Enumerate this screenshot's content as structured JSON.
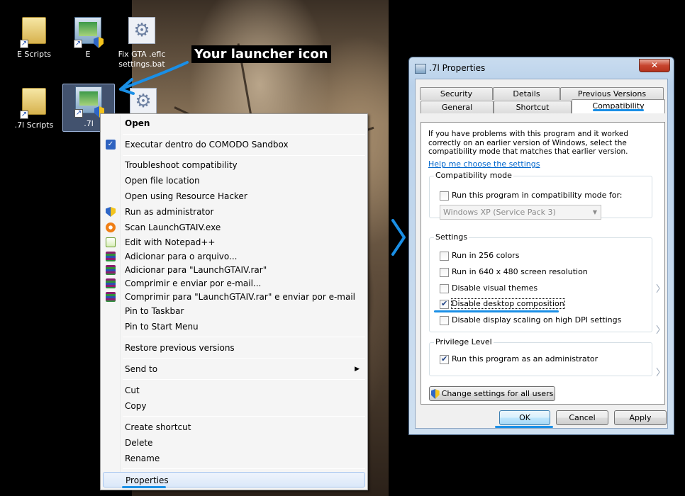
{
  "caption": "Your launcher icon",
  "desktop_icons": [
    {
      "label": "E Scripts"
    },
    {
      "label": "E"
    },
    {
      "label": "Fix GTA .eflc settings.bat"
    },
    {
      "label": ".7l Scripts"
    },
    {
      "label": ".7l"
    }
  ],
  "context_menu": {
    "items": [
      "Open",
      "Executar dentro do COMODO Sandbox",
      "Troubleshoot compatibility",
      "Open file location",
      "Open using Resource Hacker",
      "Run as administrator",
      "Scan LaunchGTAIV.exe",
      "Edit with Notepad++",
      "Adicionar para o arquivo...",
      "Adicionar para \"LaunchGTAIV.rar\"",
      "Comprimir e enviar por e-mail...",
      "Comprimir para \"LaunchGTAIV.rar\" e enviar por e-mail",
      "Pin to Taskbar",
      "Pin to Start Menu",
      "Restore previous versions",
      "Send to",
      "Cut",
      "Copy",
      "Create shortcut",
      "Delete",
      "Rename",
      "Properties"
    ],
    "submenu_arrow": "▶"
  },
  "dialog": {
    "title": ".7l Properties",
    "close": "✕",
    "tabs_row1": [
      "Security",
      "Details",
      "Previous Versions"
    ],
    "tabs_row2": [
      "General",
      "Shortcut",
      "Compatibility"
    ],
    "active_tab": "Compatibility",
    "description": "If you have problems with this program and it worked correctly on an earlier version of Windows, select the compatibility mode that matches that earlier version.",
    "help_link": "Help me choose the settings",
    "compat_mode": {
      "label": "Compatibility mode",
      "checkbox": "Run this program in compatibility mode for:",
      "checked": false,
      "select_value": "Windows XP (Service Pack 3)"
    },
    "settings": {
      "label": "Settings",
      "options": [
        {
          "text": "Run in 256 colors",
          "checked": false
        },
        {
          "text": "Run in 640 x 480 screen resolution",
          "checked": false
        },
        {
          "text": "Disable visual themes",
          "checked": false
        },
        {
          "text": "Disable desktop composition",
          "checked": true
        },
        {
          "text": "Disable display scaling on high DPI settings",
          "checked": false
        }
      ]
    },
    "privilege": {
      "label": "Privilege Level",
      "checkbox": "Run this program as an administrator",
      "checked": true
    },
    "change_all_button": "Change settings for all users",
    "ok": "OK",
    "cancel": "Cancel",
    "apply": "Apply"
  },
  "colors": {
    "annotation_blue": "#1a8fe6",
    "link": "#0066cc"
  }
}
